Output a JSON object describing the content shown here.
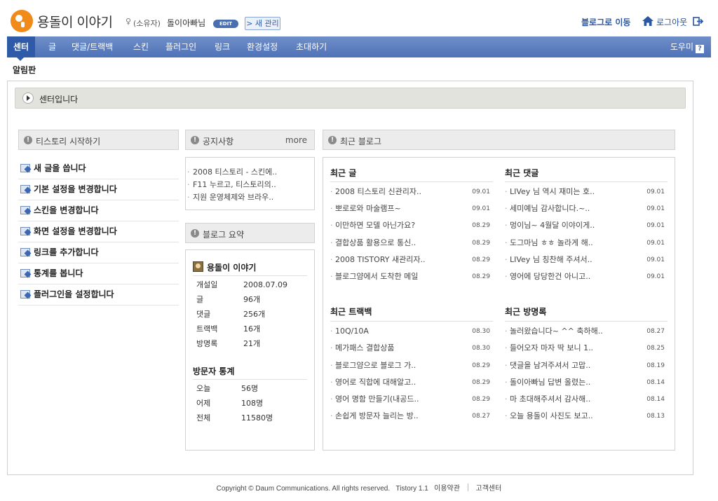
{
  "header": {
    "blog_title": "용돌이 이야기",
    "owner_role": "(소유자)",
    "owner_name": "돌이아빠님",
    "edit_badge": "EDIT",
    "new_manage": "> 새 관리",
    "goto_blog": "블로그로 이동",
    "logout": "로그아웃",
    "icons": {
      "logo": "tistory-logo-icon",
      "home": "home-icon",
      "logout": "logout-icon",
      "owner": "user-icon"
    }
  },
  "nav": {
    "items": [
      "센터",
      "글",
      "댓글/트랙백",
      "스킨",
      "플러그인",
      "링크",
      "환경설정",
      "초대하기"
    ],
    "active": "센터",
    "help": "도우미",
    "help_icon": "?"
  },
  "subnav": {
    "label": "알림판"
  },
  "center_bar": {
    "title": "센터입니다"
  },
  "start": {
    "title": "티스토리 시작하기",
    "items": [
      "새 글을 씁니다",
      "기본 설정을 변경합니다",
      "스킨을 변경합니다",
      "화면 설정을 변경합니다",
      "링크를 추가합니다",
      "통계를 봅니다",
      "플러그인을 설정합니다"
    ]
  },
  "notice": {
    "title": "공지사항",
    "more": "more",
    "items": [
      "2008 티스토리 - 스킨에..",
      "F11 누르고, 티스토리의..",
      "지원 운영체제와 브라우.."
    ]
  },
  "summary": {
    "title": "블로그 요약",
    "blog_name": "용돌이 이야기",
    "rows": [
      {
        "label": "개설일",
        "value": "2008.07.09"
      },
      {
        "label": "글",
        "value": "96개"
      },
      {
        "label": "댓글",
        "value": "256개"
      },
      {
        "label": "트랙백",
        "value": "16개"
      },
      {
        "label": "방명록",
        "value": "21개"
      }
    ],
    "visitor_title": "방문자 통계",
    "visitors": [
      {
        "label": "오늘",
        "value": "56명"
      },
      {
        "label": "어제",
        "value": "108명"
      },
      {
        "label": "전체",
        "value": "11580명"
      }
    ]
  },
  "recent": {
    "title": "최근 블로그",
    "posts": {
      "title": "최근 글",
      "items": [
        {
          "text": "2008 티스토리 신관리자..",
          "date": "09.01"
        },
        {
          "text": "뽀로로와 마술램프~",
          "date": "09.01"
        },
        {
          "text": "이만하면 모델 아닌가요?",
          "date": "08.29"
        },
        {
          "text": "결합상품 활용으로 통신..",
          "date": "08.29"
        },
        {
          "text": "2008 TISTORY 새관리자..",
          "date": "08.29"
        },
        {
          "text": "블로그얌에서 도착한 메일",
          "date": "08.29"
        }
      ]
    },
    "comments": {
      "title": "최근 댓글",
      "items": [
        {
          "text": "LIVey 님 역시 재미는 호..",
          "date": "09.01"
        },
        {
          "text": "세미예님 감사합니다.~..",
          "date": "09.01"
        },
        {
          "text": "멍이님~ 4월달 이야이게..",
          "date": "09.01"
        },
        {
          "text": "도그마님 ㅎㅎ 놀라게 해..",
          "date": "09.01"
        },
        {
          "text": "LIVey 님 칭찬해 주셔서..",
          "date": "09.01"
        },
        {
          "text": "영어에 당당한건 아니고..",
          "date": "09.01"
        }
      ]
    },
    "trackbacks": {
      "title": "최근 트랙백",
      "items": [
        {
          "text": "10Q/10A",
          "date": "08.30"
        },
        {
          "text": "메가패스 결합상품",
          "date": "08.30"
        },
        {
          "text": "블로그얌으로 블로그 가..",
          "date": "08.29"
        },
        {
          "text": "영어로 직합에 대해알고..",
          "date": "08.29"
        },
        {
          "text": "영어 명함 만들기(내공드..",
          "date": "08.29"
        },
        {
          "text": "손쉽게 방문자 늘리는 방..",
          "date": "08.27"
        }
      ]
    },
    "guestbook": {
      "title": "최근 방명록",
      "items": [
        {
          "text": "놀러왔습니다~ ^^ 축하해..",
          "date": "08.27"
        },
        {
          "text": "들어오자 마자 딱 보니 1..",
          "date": "08.25"
        },
        {
          "text": "댓글을 남겨주셔서 고맙..",
          "date": "08.19"
        },
        {
          "text": "돌이아빠님 답변 올렸는..",
          "date": "08.14"
        },
        {
          "text": "마 초대해주셔서 감사해..",
          "date": "08.14"
        },
        {
          "text": "오늘 용돌이 사진도 보고..",
          "date": "08.13"
        }
      ]
    }
  },
  "footer": {
    "copyright": "Copyright © Daum Communications. All rights reserved.",
    "version": "Tistory 1.1",
    "terms": "이용약관",
    "support": "고객센터"
  }
}
